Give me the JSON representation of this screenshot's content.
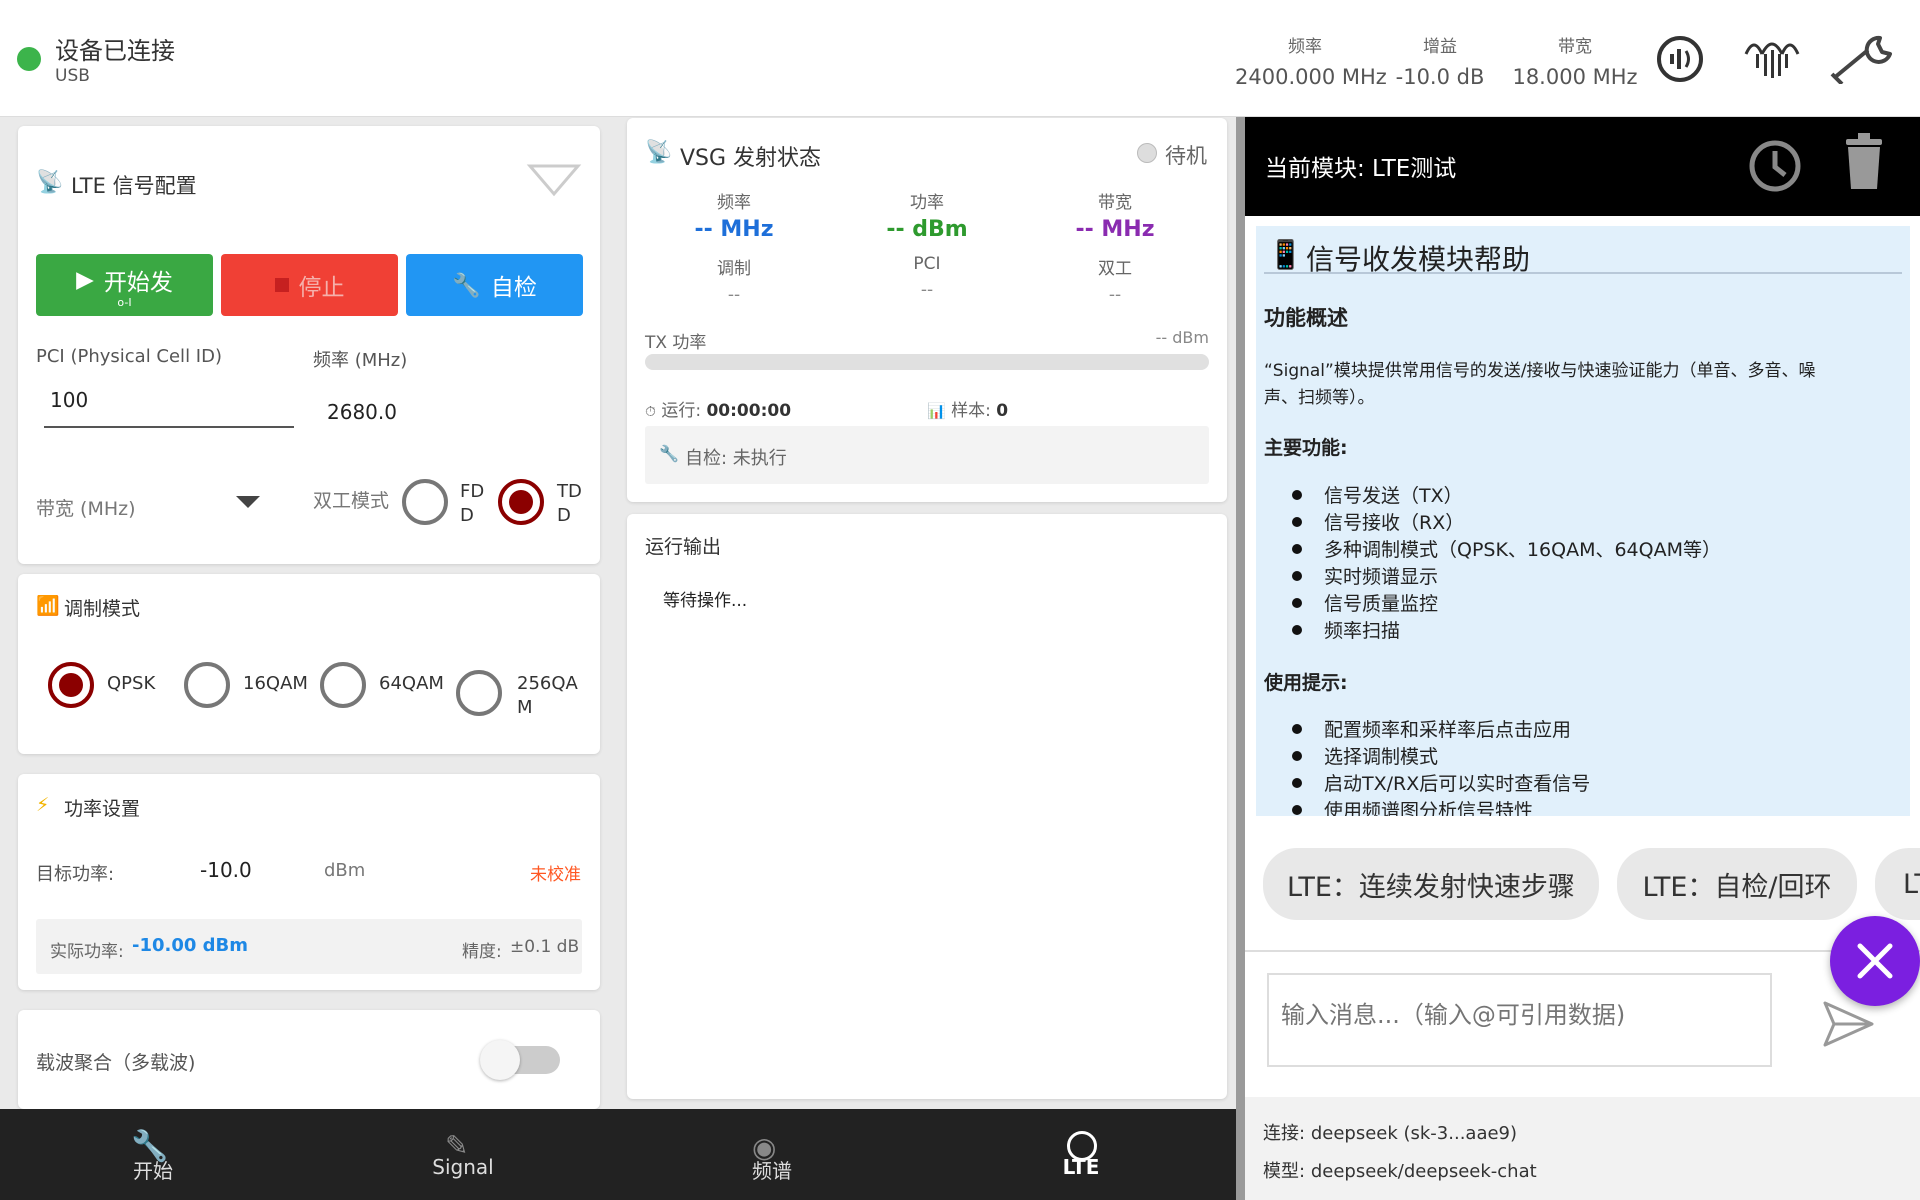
{
  "top": {
    "status_title": "设备已连接",
    "status_sub": "USB",
    "status_color": "#3cb44b",
    "stats": [
      {
        "label": "频率",
        "value": "2400.000 MHz"
      },
      {
        "label": "增益",
        "value": "-10.0 dB"
      },
      {
        "label": "带宽",
        "value": "18.000 MHz"
      }
    ],
    "icons": [
      "signal-meter-icon",
      "waveform-icon",
      "wrench-icon"
    ]
  },
  "lte_config": {
    "title": "LTE 信号配置",
    "start_label": "开始发",
    "start_sub": "o-I",
    "stop_label": "停止",
    "selftest_label": "自检",
    "pci_label": "PCI (Physical Cell ID)",
    "pci_value": "100",
    "freq_label": "频率 (MHz)",
    "freq_value": "2680.0",
    "bw_label": "带宽 (MHz)",
    "duplex_label": "双工模式",
    "duplex_fdd": "FD\nD",
    "duplex_tdd": "TD\nD",
    "duplex_selected": "TDD"
  },
  "modulation": {
    "title": "调制模式",
    "options": [
      "QPSK",
      "16QAM",
      "64QAM",
      "256QA\nM"
    ],
    "selected": "QPSK"
  },
  "power": {
    "title": "功率设置",
    "target_label": "目标功率:",
    "target_value": "-10.0",
    "target_unit": "dBm",
    "calib": "未校准",
    "actual_label": "实际功率:",
    "actual_value": "-10.00 dBm",
    "precision_label": "精度:",
    "precision_value": "±0.1 dB"
  },
  "ca": {
    "label": "载波聚合（多载波)",
    "enabled": false
  },
  "vsg": {
    "title": "VSG 发射状态",
    "state": "待机",
    "metrics": [
      {
        "label": "频率",
        "value": "-- MHz",
        "color": "#1e6fd9"
      },
      {
        "label": "功率",
        "value": "-- dBm",
        "color": "#2e9a2e"
      },
      {
        "label": "带宽",
        "value": "-- MHz",
        "color": "#8a2bb0"
      },
      {
        "label": "调制",
        "value": "--"
      },
      {
        "label": "PCI",
        "value": "--"
      },
      {
        "label": "双工",
        "value": "--"
      }
    ],
    "tx_power_label": "TX 功率",
    "tx_power_value": "-- dBm",
    "tx_power_fraction": 0,
    "runtime_label": "运行:",
    "runtime_value": "00:00:00",
    "samples_label": "样本:",
    "samples_value": "0",
    "selftest": "自检: 未执行"
  },
  "output": {
    "title": "运行输出",
    "text": "等待操作..."
  },
  "assistant": {
    "module": "当前模块: LTE测试",
    "help_title": "信号收发模块帮助",
    "overview_title": "功能概述",
    "overview_text_1": "“Signal”模块提供常用信号的发送/接收与快速验证能力（单音、多音、噪",
    "overview_text_2": "声、扫频等）。",
    "main_title": "主要功能:",
    "main_items": [
      "信号发送（TX）",
      "信号接收（RX）",
      "多种调制模式（QPSK、16QAM、64QAM等）",
      "实时频谱显示",
      "信号质量监控",
      "频率扫描"
    ],
    "tips_title": "使用提示:",
    "tips_items": [
      "配置频率和采样率后点击应用",
      "选择调制模式",
      "启动TX/RX后可以实时查看信号",
      "使用频谱图分析信号特性"
    ],
    "chips": [
      "LTE：连续发射快速步骤",
      "LTE：自检/回环",
      "LT"
    ],
    "input_placeholder": "输入消息...（输入@可引用数据)",
    "conn_label": "连接:",
    "conn_value": "deepseek (sk-3...aae9)",
    "model_label": "模型:",
    "model_value": "deepseek/deepseek-chat",
    "fab_color": "#7b1fe0"
  },
  "nav": [
    "开始",
    "Signal",
    "频谱",
    "LTE"
  ]
}
